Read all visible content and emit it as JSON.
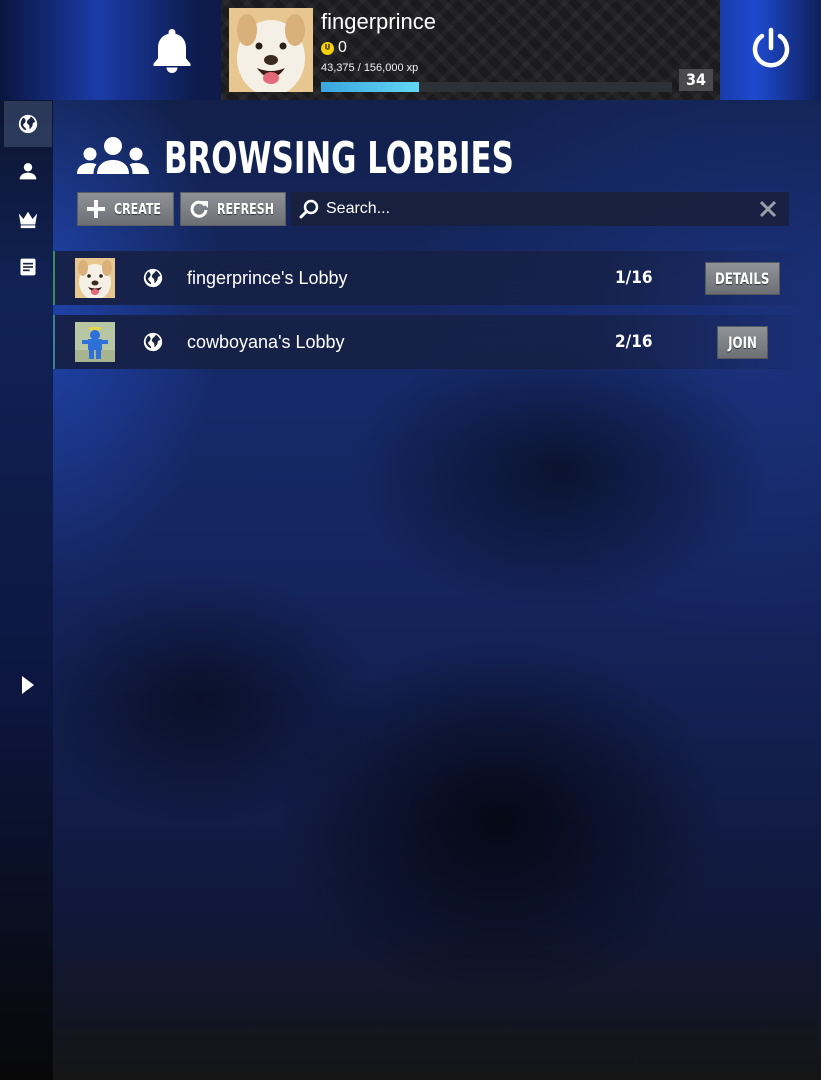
{
  "header": {
    "username": "fingerprince",
    "coins": "0",
    "xp_text": "43,375 / 156,000 xp",
    "xp_fraction": 0.278,
    "level": "34"
  },
  "colors": {
    "accent_xp": "#4cc3ec",
    "coin": "#f4d10a",
    "button": "#7d8085"
  },
  "sidebar": {
    "items": [
      {
        "icon": "globe-icon",
        "active": true
      },
      {
        "icon": "person-icon",
        "active": false
      },
      {
        "icon": "crown-icon",
        "active": false
      },
      {
        "icon": "document-icon",
        "active": false
      },
      {
        "icon": "play-arrow-icon",
        "active": false
      }
    ]
  },
  "main": {
    "title": "BROWSING LOBBIES",
    "create_label": "CREATE",
    "refresh_label": "REFRESH",
    "search_placeholder": "Search..."
  },
  "lobbies": [
    {
      "name": "fingerprince's Lobby",
      "players": "1/16",
      "action": "DETAILS"
    },
    {
      "name": "cowboyana's Lobby",
      "players": "2/16",
      "action": "JOIN"
    }
  ]
}
